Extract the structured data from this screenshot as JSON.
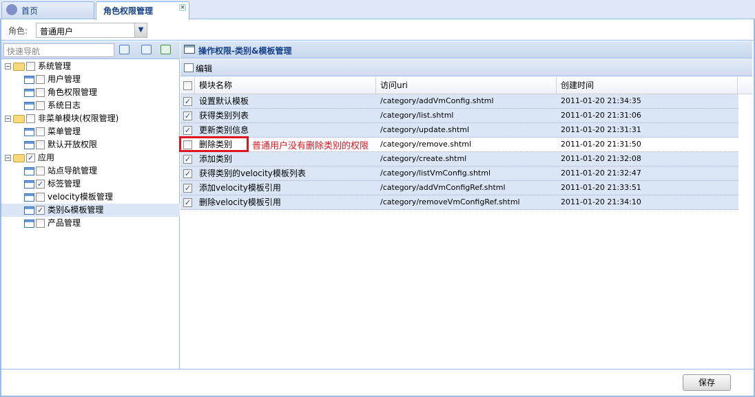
{
  "tabs": [
    {
      "label": "首页",
      "icon": "home-help-icon"
    },
    {
      "label": "角色权限管理",
      "closable": true
    }
  ],
  "role": {
    "label": "角色:",
    "value": "普通用户"
  },
  "nav": {
    "placeholder": "快速导航",
    "tree": [
      {
        "label": "系统管理",
        "type": "folder",
        "checked": false
      },
      {
        "label": "用户管理",
        "type": "leaf",
        "checked": false
      },
      {
        "label": "角色权限管理",
        "type": "leaf",
        "checked": false
      },
      {
        "label": "系统日志",
        "type": "leaf",
        "checked": false
      },
      {
        "label": "非菜单模块(权限管理)",
        "type": "folder",
        "checked": false
      },
      {
        "label": "菜单管理",
        "type": "leaf",
        "checked": false
      },
      {
        "label": "默认开放权限",
        "type": "leaf",
        "checked": false
      },
      {
        "label": "应用",
        "type": "folder",
        "checked": true
      },
      {
        "label": "站点导航管理",
        "type": "leaf",
        "checked": false
      },
      {
        "label": "标签管理",
        "type": "leaf",
        "checked": true
      },
      {
        "label": "velocity模板管理",
        "type": "leaf",
        "checked": false
      },
      {
        "label": "类别&模板管理",
        "type": "leaf",
        "checked": true,
        "selected": true
      },
      {
        "label": "产品管理",
        "type": "leaf",
        "checked": false
      }
    ]
  },
  "panel": {
    "title": "操作权限-类别&模板管理",
    "edit_label": "编辑",
    "columns": [
      "模块名称",
      "访问uri",
      "创建时间"
    ],
    "rows": [
      {
        "name": "设置默认模板",
        "uri": "/category/addVmConfig.shtml",
        "time": "2011-01-20 21:34:35",
        "checked": true
      },
      {
        "name": "获得类别列表",
        "uri": "/category/list.shtml",
        "time": "2011-01-20 21:31:06",
        "checked": true
      },
      {
        "name": "更新类别信息",
        "uri": "/category/update.shtml",
        "time": "2011-01-20 21:31:31",
        "checked": true
      },
      {
        "name": "删除类别",
        "uri": "/category/remove.shtml",
        "time": "2011-01-20 21:31:50",
        "checked": false
      },
      {
        "name": "添加类别",
        "uri": "/category/create.shtml",
        "time": "2011-01-20 21:32:08",
        "checked": true
      },
      {
        "name": "获得类别的velocity模板列表",
        "uri": "/category/listVmConfig.shtml",
        "time": "2011-01-20 21:32:47",
        "checked": true
      },
      {
        "name": "添加velocity模板引用",
        "uri": "/category/addVmConfigRef.shtml",
        "time": "2011-01-20 21:33:51",
        "checked": true
      },
      {
        "name": "删除velocity模板引用",
        "uri": "/category/removeVmConfigRef.shtml",
        "time": "2011-01-20 21:34:10",
        "checked": true
      }
    ]
  },
  "annotation": "普通用户没有删除类别的权限",
  "save_label": "保存",
  "colors": {
    "accent": "#15428b",
    "border": "#99bbe8",
    "annotation": "#e0141e"
  }
}
